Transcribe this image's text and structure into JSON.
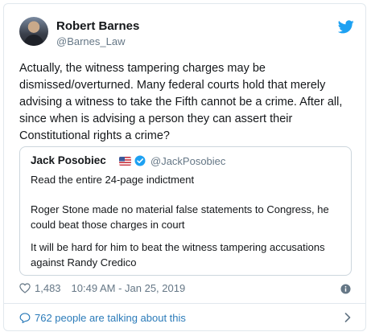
{
  "author": {
    "name": "Robert Barnes",
    "handle": "@Barnes_Law"
  },
  "tweet": {
    "line1": "Actually, the witness tampering charges may be",
    "line2": "dismissed/overturned. Many federal courts hold that merely",
    "line3": "advising a witness to take the Fifth cannot be a crime. After all,",
    "line4": "since when is advising a person they can assert their",
    "line5": "Constitutional rights a crime?"
  },
  "quoted": {
    "name": "Jack Posobiec",
    "handle": "@JackPosobiec",
    "para1": "Read the entire 24-page indictment",
    "para2_line1": "Roger Stone made no material false statements to Congress, he",
    "para2_line2": "could beat those charges in court",
    "para3_line1": "It will be hard for him to beat the witness tampering accusations",
    "para3_line2": "against Randy Credico"
  },
  "meta": {
    "likes": "1,483",
    "timestamp": "10:49 AM - Jan 25, 2019"
  },
  "footer": {
    "talking": "762 people are talking about this"
  },
  "icons": {
    "bird": "twitter-bird-icon",
    "flag": "us-flag-icon",
    "verified": "verified-badge-icon",
    "heart": "heart-icon",
    "info": "info-icon",
    "bubble": "speech-bubble-icon",
    "chevron": "chevron-right-icon"
  },
  "colors": {
    "brand_blue": "#1da1f2",
    "link_blue": "#2b7bb9",
    "muted": "#657786",
    "text": "#14171a",
    "border": "#e1e8ed"
  }
}
